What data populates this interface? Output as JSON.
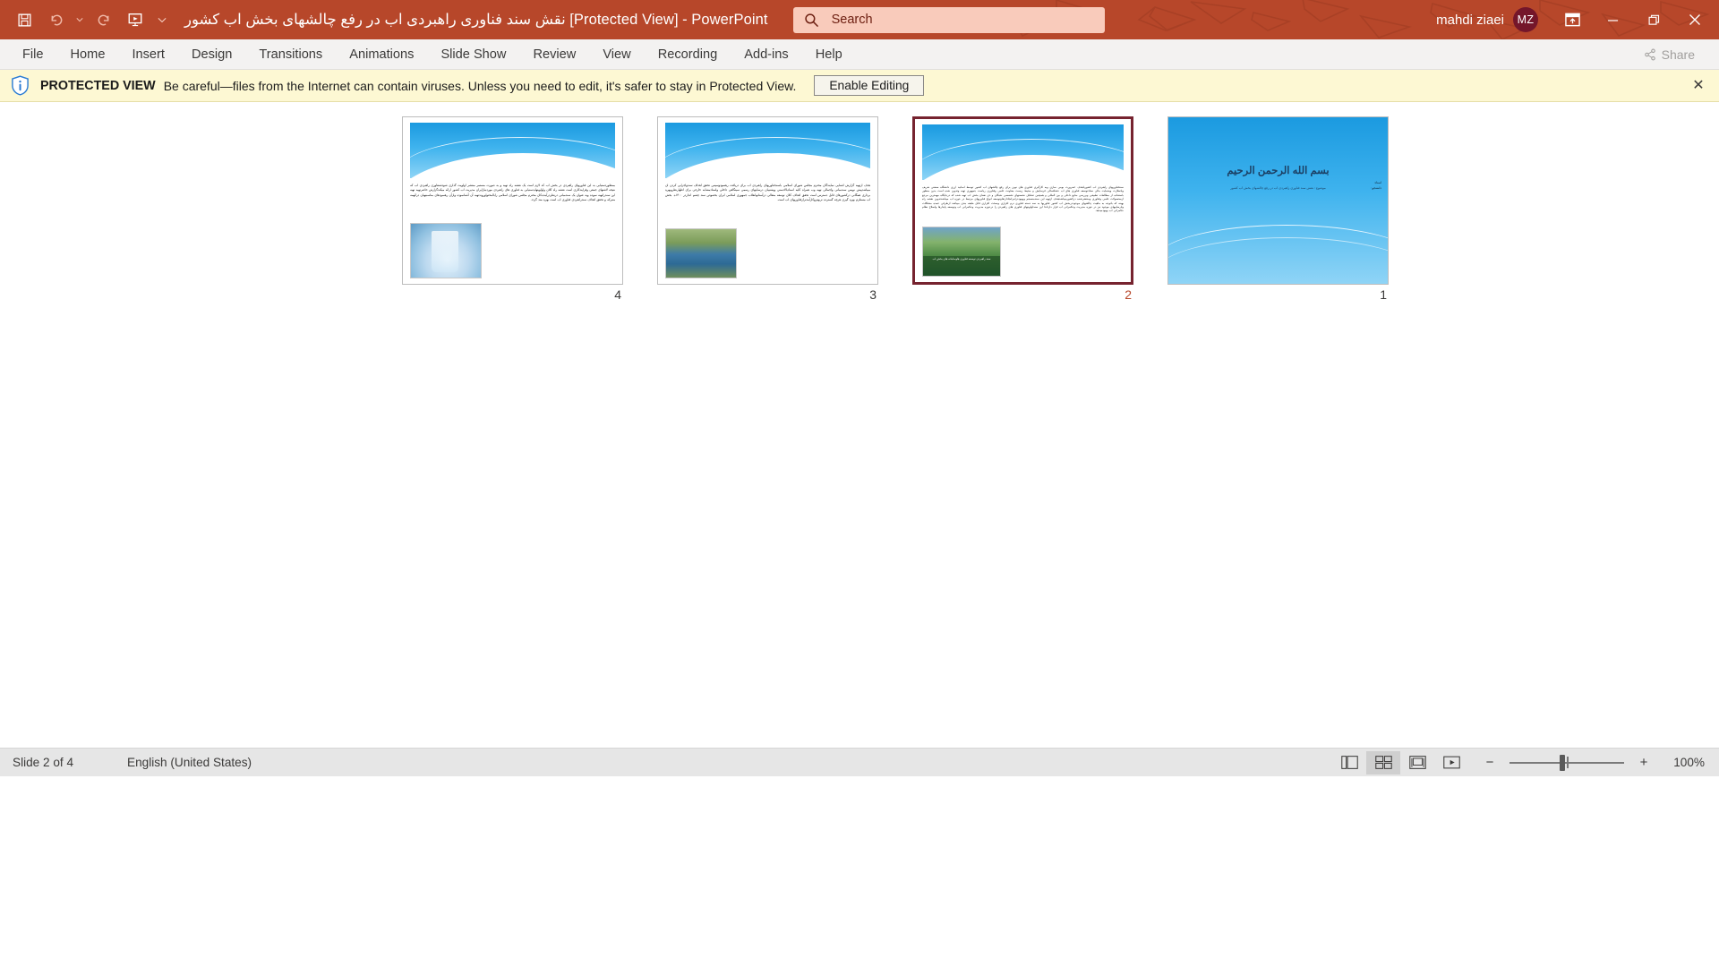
{
  "titlebar": {
    "document_title_rtl": "نقش سند فناوری راهبردی اب در رفع چالشهای بخش اب کشور",
    "protected_suffix": "[Protected View]",
    "app_separator": "-",
    "app_name": "PowerPoint",
    "search_placeholder": "Search",
    "user_name": "mahdi ziaei",
    "user_initials": "MZ",
    "accent_color": "#b7472a",
    "search_bg": "#f9cbbb",
    "avatar_color": "#74162a"
  },
  "ribbon": {
    "tabs": [
      {
        "label": "File"
      },
      {
        "label": "Home"
      },
      {
        "label": "Insert"
      },
      {
        "label": "Design"
      },
      {
        "label": "Transitions"
      },
      {
        "label": "Animations"
      },
      {
        "label": "Slide Show"
      },
      {
        "label": "Review"
      },
      {
        "label": "View"
      },
      {
        "label": "Recording"
      },
      {
        "label": "Add-ins"
      },
      {
        "label": "Help"
      }
    ],
    "share_label": "Share"
  },
  "protected_view": {
    "label": "PROTECTED VIEW",
    "message": "Be careful—files from the Internet can contain viruses. Unless you need to edit, it's safer to stay in Protected View.",
    "enable_button": "Enable Editing",
    "close_glyph": "✕",
    "bar_color": "#fdf8d3"
  },
  "slides": [
    {
      "number": "4",
      "selected": false,
      "layout": "content",
      "body_rtl": "بمنظوردستیابی به این فناوریهای راهبردی در بخش اب که لازم است یک نقشه راه تهیه و به صورت مستمر منتشر اولویت گذاری شودشنفاوری راهبردی اب که نتیجه لاشتهای جمعی وفرایندکاری است نقشه راه کلان واولویتهایدستیابی به فناوری های راهبردی موردنیازایران مدیریت اب کشور ارائه میکندگزارش حاضرتهیه تهیه این سندراتهیه نموده وبه عنوان یک سندمبانی درنظردرآینده‌کان محترم مجلس شورای اسلامی راباامحتواوروندتهیه آن آشنانموده وازآن رهنمودهای مناسبتهیان درائهمه متبرکه و تحقق اهداف سندراهبردی فناوری اب است بهره مند گردد.",
      "image": "glass-of-water"
    },
    {
      "number": "3",
      "selected": false,
      "layout": "content",
      "body_rtl": "هدف ازتهیه گزارش آشنایی نمایندگان محترم مجلس شورای اسلامی باسندفناوریهای راهبردی اب برای دریافت رهنمودوسپس تحقق اهداف سندواجرایی کردن آن میباشدپیش نویس سندمبانی واجمالی تهیه وب همراه کلیه اسنادبالادستی وپشتیبان درسایتهای رسمی سیتگاهی داخلی واستادمشابه خارجی برای اظهارنظروبهره برداری همگانی درکشورهای قابل دسترس است تحقق اهداف کلان توسعه متعالی درآستانهانقلاب جمهوری اسلامی ایران بخصوص سند چشم اندازدر ۱۴۰۰ه. بخش اب مستلزم بهره گیری هرچه گسترده تربهتروکارآمدترازفناوریهای اب است.",
      "image": "river-dam"
    },
    {
      "number": "2",
      "selected": true,
      "layout": "content-dense",
      "body_rtl": "سندفناوریهای راهبردی اب کشورباهدف ۱ضرورت بومی سازی وبه کارگیری فناوری های نوین برای رفع چالشهای اب کشور توسط اساتید ارزی دانشگاه صنعتی شریف وباتظارت ویحمایت مالی ستادتوسعه فناوری های اب خشکسالی فرسایش و محیط زیست معاونت علمی وفناوری ریاست جمهوری تهیه وتدوین شده است بدین منظور باستفاده از مطالعات تطبیقی وبررسی منابع داخلی و بین المللی و همچنین تشکیل نشستهای تخصصی نخبگان و ذی نفعان بخش اب تهیه شده که درجایگاه مهمترین مرجع ازمحصولات علمی وفناوری ومنتشرشده درکشورمیباشدهدف ازتهیه این سندمنسجم وبهبوددرامرانجاذارتقاوتوسعه انواع فناوریهای مرتبط در حوزه اب میباشدتدوین نقشه راه بهینه که باتوجه به ماهیت چالشهای موجوددربخش اب کشور فناوریها به سه دسته فناوری نرم افزاری وسخت افزاری قابل طبقه بندی میباشد ازطرفی عمده مشکلات ونارساییهای موجود نیز در حوزه مدیریت وحکمرانی اب قرار داردلذا این سنداولویتهای فناوری های راهبردی را درحوزه مدیریت وحکمرانی اب وتوسعه پایدارها واصلاح نظام حکمرانی اب بهبودمیدهد.",
      "image": "dam-photo",
      "image_caption_rtl": "سند راهبردی توسعه فناوری هاوسامانه های بخش اب"
    },
    {
      "number": "1",
      "selected": false,
      "layout": "title",
      "title_rtl": "بسم الله الرحمن الرحیم",
      "subtitle1_rtl": "موضوع : نقش سند فناوری راهبردی اب در رفع چالشهای بخش اب کشور",
      "label_ostad_rtl": "استاد:",
      "label_danesh_rtl": "دانشجو :"
    }
  ],
  "statusbar": {
    "slide_position": "Slide 2 of 4",
    "language": "English (United States)",
    "views": [
      {
        "name": "normal-view",
        "active": false
      },
      {
        "name": "slide-sorter-view",
        "active": true
      },
      {
        "name": "reading-view",
        "active": false
      },
      {
        "name": "slide-show-view",
        "active": false
      }
    ],
    "zoom_minus": "−",
    "zoom_plus": "+",
    "zoom_value": "100%"
  }
}
